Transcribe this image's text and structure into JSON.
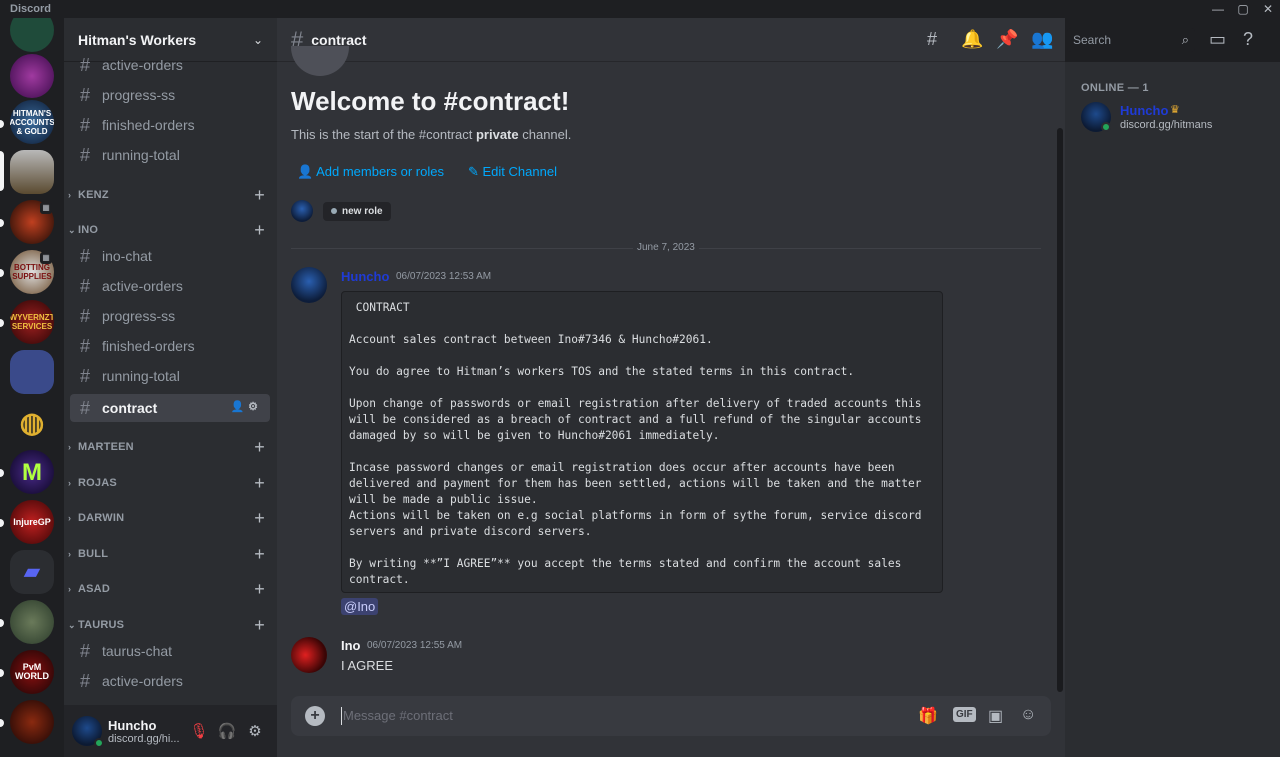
{
  "app": {
    "title": "Discord"
  },
  "window_controls": [
    "—",
    "▢",
    "✕"
  ],
  "servers": [
    {
      "name": "server-1",
      "bg": "#1f4b3a",
      "label": ""
    },
    {
      "name": "server-2",
      "bg": "#5b1a7a",
      "label": ""
    },
    {
      "name": "hitmans-workers",
      "bg": "#1c3350",
      "label": "HITMAN'S ACCOUNTS & GOLD"
    },
    {
      "name": "server-4",
      "bg": "#6b5a3a",
      "label": ""
    },
    {
      "name": "server-5",
      "bg": "#3a1a10",
      "label": ""
    },
    {
      "name": "server-6",
      "bg": "#3a2a1a",
      "label": "BOTTING SUPPLIES"
    },
    {
      "name": "wyvernzt",
      "bg": "#5a1a1a",
      "label": "WYVERNZT SERVICES"
    },
    {
      "name": "server-8",
      "bg": "#2a3a6a",
      "label": ""
    },
    {
      "name": "server-9",
      "bg": "#1e1f22",
      "label": ""
    },
    {
      "name": "server-10",
      "bg": "#3a1060",
      "label": "M"
    },
    {
      "name": "injuregp",
      "bg": "#7a1010",
      "label": "InjureGP"
    },
    {
      "name": "folder",
      "bg": "#2b2d31",
      "label": ""
    },
    {
      "name": "server-13",
      "bg": "#3a4a3a",
      "label": ""
    },
    {
      "name": "pvm-world",
      "bg": "#5a0a0a",
      "label": "PvM WORLD"
    },
    {
      "name": "server-15",
      "bg": "#3a1a1a",
      "label": ""
    }
  ],
  "guild": {
    "name": "Hitman's Workers",
    "chevron": "⌄"
  },
  "channels_top": [
    "active-orders",
    "progress-ss",
    "finished-orders",
    "running-total"
  ],
  "categories": {
    "kenz": "KENZ",
    "ino": "INO",
    "marteen": "MARTEEN",
    "rojas": "ROJAS",
    "darwin": "DARWIN",
    "bull": "BULL",
    "asad": "ASAD",
    "taurus": "TAURUS"
  },
  "ino_channels": [
    "ino-chat",
    "active-orders",
    "progress-ss",
    "finished-orders",
    "running-total",
    "contract"
  ],
  "taurus_channels": [
    "taurus-chat",
    "active-orders"
  ],
  "user": {
    "name": "Huncho",
    "status": "discord.gg/hi..."
  },
  "channel": {
    "name": "contract"
  },
  "search": {
    "placeholder": "Search"
  },
  "welcome": {
    "title": "Welcome to #contract!",
    "sub_prefix": "This is the start of the #contract ",
    "sub_bold": "private",
    "sub_suffix": " channel.",
    "add_members": "Add members or roles",
    "edit_channel": "Edit Channel",
    "role": "new role"
  },
  "date_divider": "June 7, 2023",
  "messages": [
    {
      "author": "Huncho",
      "author_color": "#1f3bd6",
      "time": "06/07/2023 12:53 AM",
      "code": " CONTRACT\n\nAccount sales contract between Ino#7346 & Huncho#2061.\n\nYou do agree to Hitman’s workers TOS and the stated terms in this contract.\n\nUpon change of passwords or email registration after delivery of traded accounts this will be considered as a breach of contract and a full refund of the singular accounts damaged by so will be given to Huncho#2061 immediately.\n\nIncase password changes or email registration does occur after accounts have been delivered and payment for them has been settled, actions will be taken and the matter will be made a public issue.\nActions will be taken on e.g social platforms in form of sythe forum, service discord servers and private discord servers.\n\nBy writing **”I AGREE”** you accept the terms stated and confirm the account sales contract.",
      "mention": "@Ino"
    },
    {
      "author": "Ino",
      "author_color": "#f2f3f5",
      "time": "06/07/2023 12:55 AM",
      "text": "I AGREE"
    }
  ],
  "composer": {
    "placeholder": "Message #contract",
    "gif": "GIF"
  },
  "members": {
    "header": "ONLINE — 1",
    "list": [
      {
        "name": "Huncho",
        "status": "discord.gg/hitmans"
      }
    ]
  }
}
